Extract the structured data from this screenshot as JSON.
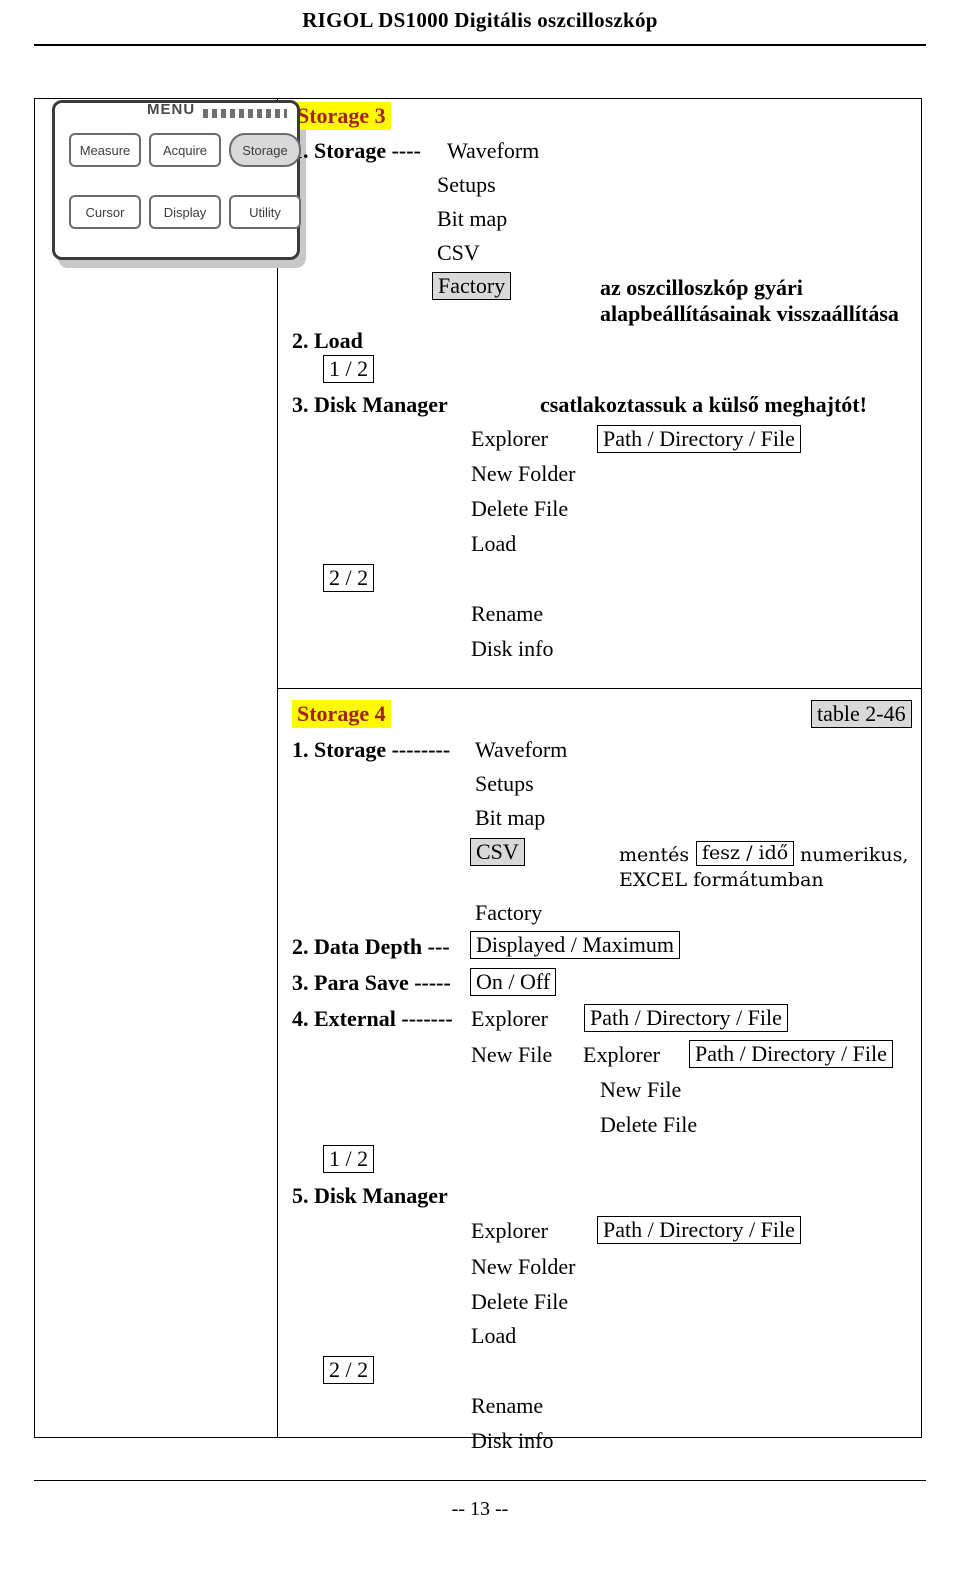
{
  "header": {
    "title": "RIGOL DS1000 Digitális oszcilloszkóp"
  },
  "panel": {
    "menu_label": "MENU",
    "keys": [
      "Measure",
      "Acquire",
      "Storage",
      "Cursor",
      "Display",
      "Utility"
    ]
  },
  "storage3": {
    "heading": "Storage 3",
    "item1": "1. Storage ----",
    "item1_value": "Waveform",
    "sub_setups": "Setups",
    "sub_bitmap": "Bit map",
    "sub_csv": "CSV",
    "sub_factory": "Factory",
    "factory_note_line1": "az oszcilloszkóp gyári",
    "factory_note_line2": "alapbeállításainak visszaállítása",
    "item2": "2. Load",
    "page_1_2": "1 / 2",
    "item3": "3. Disk Manager",
    "item3_note": "csatlakoztassuk a külső meghajtót!",
    "explorer": "Explorer",
    "explorer_value": "Path / Directory / File",
    "new_folder": "New Folder",
    "delete_file": "Delete File",
    "load": "Load",
    "page_2_2": "2 / 2",
    "rename": "Rename",
    "disk_info": "Disk info"
  },
  "storage4": {
    "heading": "Storage 4",
    "table_ref": "table 2-46",
    "item1": "1. Storage --------",
    "item1_value": "Waveform",
    "sub_setups": "Setups",
    "sub_bitmap": "Bit map",
    "sub_csv": "CSV",
    "csv_note_part1": "mentés",
    "csv_note_boxed": "fesz / idő",
    "csv_note_part2": "numerikus,",
    "csv_note_line2": "EXCEL formátumban",
    "sub_factory": "Factory",
    "item2": "2. Data Depth ---",
    "item2_value": "Displayed / Maximum",
    "item3": "3. Para Save -----",
    "item3_value": "On / Off",
    "item4": "4. External -------",
    "item4_explorer": "Explorer",
    "item4_explorer_value": "Path / Directory / File",
    "new_file": "New File",
    "new_file_explorer": "Explorer",
    "new_file_explorer_value": "Path / Directory / File",
    "new_file_2": "New File",
    "delete_file": "Delete File",
    "page_1_2": "1 / 2",
    "item5": "5. Disk Manager",
    "explorer": "Explorer",
    "explorer_value": "Path / Directory / File",
    "new_folder": "New Folder",
    "delete_file_2": "Delete File",
    "load": "Load",
    "page_2_2": "2 / 2",
    "rename": "Rename",
    "disk_info": "Disk info"
  },
  "footer": {
    "page_number": "-- 13 --"
  }
}
